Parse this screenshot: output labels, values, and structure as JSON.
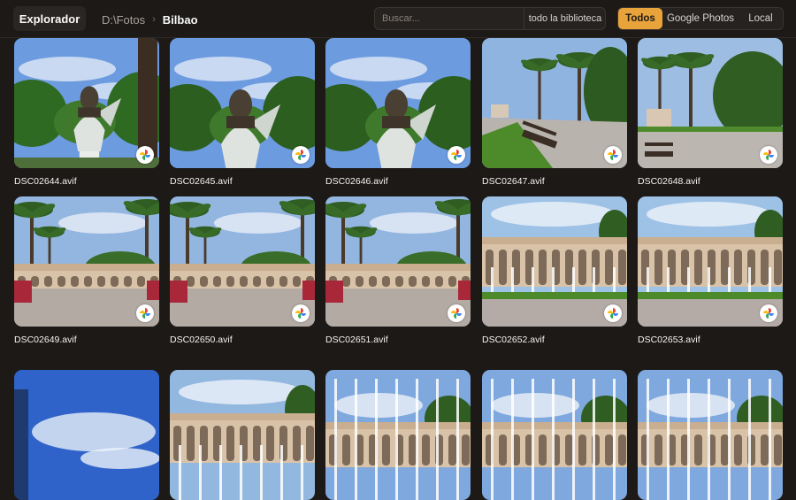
{
  "header": {
    "app_title": "Explorador",
    "breadcrumb": {
      "root": "D:\\Fotos",
      "separator": "›",
      "current": "Bilbao"
    }
  },
  "search": {
    "placeholder": "Buscar...",
    "value": "",
    "scope": "todo la biblioteca"
  },
  "filters": {
    "options": [
      "Todos",
      "Google Photos",
      "Local"
    ],
    "selected": "Todos"
  },
  "badge_icon": "google-photos-icon",
  "files": [
    {
      "name": "DSC02644.avif",
      "scene": "statue-far",
      "source": "google-photos"
    },
    {
      "name": "DSC02645.avif",
      "scene": "statue",
      "source": "google-photos"
    },
    {
      "name": "DSC02646.avif",
      "scene": "statue",
      "source": "google-photos"
    },
    {
      "name": "DSC02647.avif",
      "scene": "park-bench",
      "source": "google-photos"
    },
    {
      "name": "DSC02648.avif",
      "scene": "park-bench-wide",
      "source": "google-photos"
    },
    {
      "name": "DSC02649.avif",
      "scene": "palm-avenue",
      "source": "google-photos"
    },
    {
      "name": "DSC02650.avif",
      "scene": "palm-avenue",
      "source": "google-photos"
    },
    {
      "name": "DSC02651.avif",
      "scene": "palm-avenue",
      "source": "google-photos"
    },
    {
      "name": "DSC02652.avif",
      "scene": "colonnade",
      "source": "google-photos"
    },
    {
      "name": "DSC02653.avif",
      "scene": "colonnade",
      "source": "google-photos"
    },
    {
      "name": "",
      "scene": "tower-sky"
    },
    {
      "name": "",
      "scene": "colonnade-low"
    },
    {
      "name": "",
      "scene": "fountain"
    },
    {
      "name": "",
      "scene": "fountain"
    },
    {
      "name": "",
      "scene": "fountain"
    }
  ],
  "colors": {
    "accent": "#e8a43a",
    "background": "#1c1917"
  }
}
